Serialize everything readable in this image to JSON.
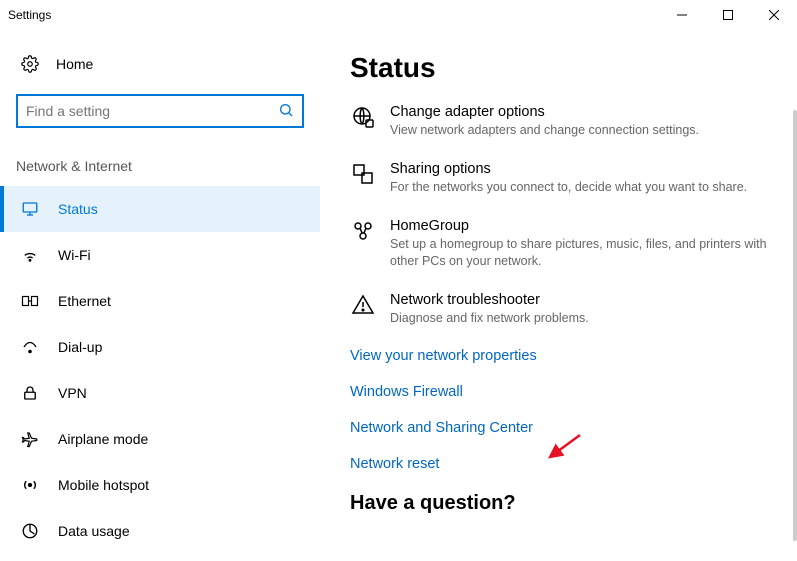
{
  "window": {
    "title": "Settings"
  },
  "sidebar": {
    "home_label": "Home",
    "search_placeholder": "Find a setting",
    "category": "Network & Internet",
    "items": [
      {
        "label": "Status"
      },
      {
        "label": "Wi-Fi"
      },
      {
        "label": "Ethernet"
      },
      {
        "label": "Dial-up"
      },
      {
        "label": "VPN"
      },
      {
        "label": "Airplane mode"
      },
      {
        "label": "Mobile hotspot"
      },
      {
        "label": "Data usage"
      }
    ]
  },
  "main": {
    "heading": "Status",
    "options": [
      {
        "title": "Change adapter options",
        "desc": "View network adapters and change connection settings."
      },
      {
        "title": "Sharing options",
        "desc": "For the networks you connect to, decide what you want to share."
      },
      {
        "title": "HomeGroup",
        "desc": "Set up a homegroup to share pictures, music, files, and printers with other PCs on your network."
      },
      {
        "title": "Network troubleshooter",
        "desc": "Diagnose and fix network problems."
      }
    ],
    "links": [
      "View your network properties",
      "Windows Firewall",
      "Network and Sharing Center",
      "Network reset"
    ],
    "question": "Have a question?"
  }
}
